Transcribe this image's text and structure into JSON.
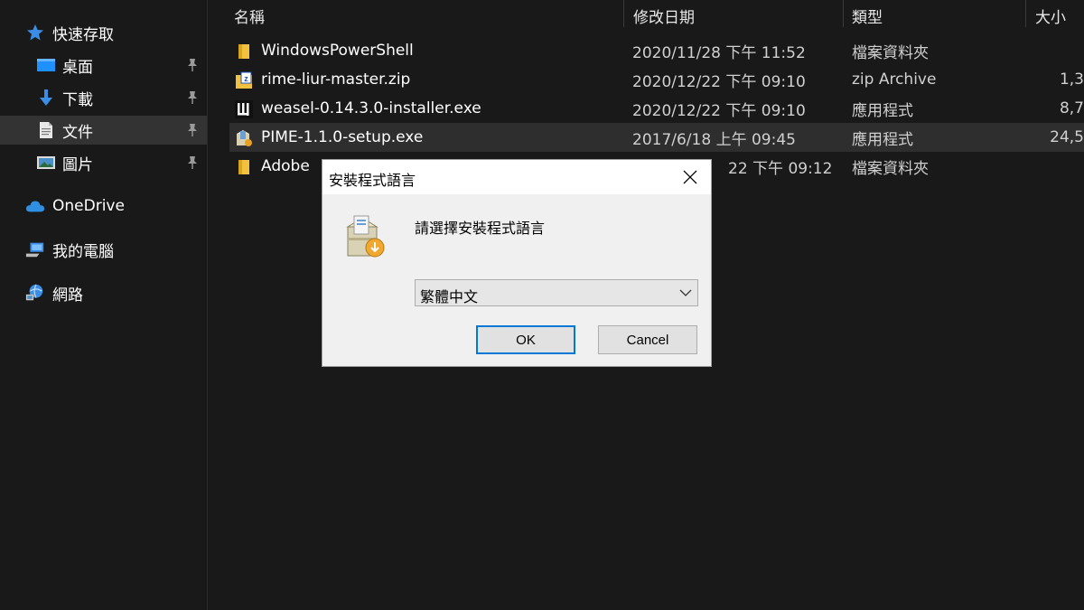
{
  "sidebar": {
    "quick_access": "快速存取",
    "items": [
      {
        "label": "桌面",
        "icon": "desktop-icon"
      },
      {
        "label": "下載",
        "icon": "download-icon"
      },
      {
        "label": "文件",
        "icon": "documents-icon"
      },
      {
        "label": "圖片",
        "icon": "pictures-icon"
      }
    ],
    "onedrive": "OneDrive",
    "this_pc": "我的電腦",
    "network": "網路"
  },
  "columns": {
    "name": "名稱",
    "date": "修改日期",
    "type": "類型",
    "size": "大小"
  },
  "files": [
    {
      "name": "WindowsPowerShell",
      "date": "2020/11/28 下午 11:52",
      "type": "檔案資料夾",
      "size": ""
    },
    {
      "name": "rime-liur-master.zip",
      "date": "2020/12/22 下午 09:10",
      "type": "zip Archive",
      "size": "1,3"
    },
    {
      "name": "weasel-0.14.3.0-installer.exe",
      "date": "2020/12/22 下午 09:10",
      "type": "應用程式",
      "size": "8,7"
    },
    {
      "name": "PIME-1.1.0-setup.exe",
      "date": "2017/6/18 上午 09:45",
      "type": "應用程式",
      "size": "24,5"
    },
    {
      "name": "Adobe",
      "date": "22 下午 09:12",
      "type": "檔案資料夾",
      "size": ""
    }
  ],
  "dialog": {
    "title": "安裝程式語言",
    "prompt": "請選擇安裝程式語言",
    "selected_language": "繁體中文",
    "ok_label": "OK",
    "cancel_label": "Cancel"
  },
  "colors": {
    "background": "#191919",
    "selected_row": "#2e2e2e",
    "accent_blue": "#0078d7",
    "folder_yellow": "#f3c140"
  }
}
